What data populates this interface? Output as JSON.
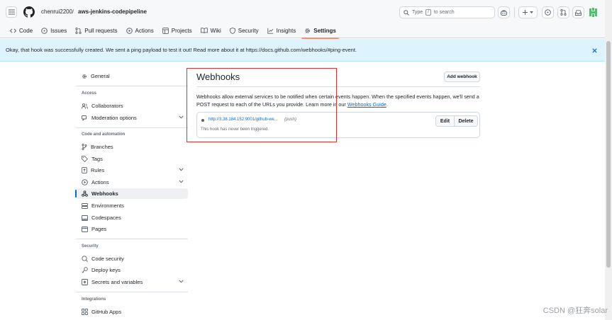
{
  "header": {
    "owner": "chenrui2200",
    "separator": "/",
    "repo": "aws-jenkins-codepipeline",
    "search": {
      "prefix": "Type",
      "key": "/",
      "suffix": "to search"
    }
  },
  "nav": {
    "tabs": [
      {
        "label": "Code",
        "icon": "code-icon"
      },
      {
        "label": "Issues",
        "icon": "issue-icon"
      },
      {
        "label": "Pull requests",
        "icon": "pull-request-icon"
      },
      {
        "label": "Actions",
        "icon": "play-icon"
      },
      {
        "label": "Projects",
        "icon": "table-icon"
      },
      {
        "label": "Wiki",
        "icon": "book-icon"
      },
      {
        "label": "Security",
        "icon": "shield-icon"
      },
      {
        "label": "Insights",
        "icon": "graph-icon"
      },
      {
        "label": "Settings",
        "icon": "gear-icon",
        "active": true
      }
    ]
  },
  "flash": {
    "message": "Okay, that hook was successfully created. We sent a ping payload to test it out! Read more about it at https://docs.github.com/webhooks/#ping-event."
  },
  "sidebar": {
    "general": "General",
    "sections": {
      "access": "Access",
      "code_automation": "Code and automation",
      "security": "Security",
      "integrations": "Integrations"
    },
    "items": {
      "collaborators": "Collaborators",
      "moderation": "Moderation options",
      "branches": "Branches",
      "tags": "Tags",
      "rules": "Rules",
      "actions": "Actions",
      "webhooks": "Webhooks",
      "environments": "Environments",
      "codespaces": "Codespaces",
      "pages": "Pages",
      "code_security": "Code security",
      "deploy_keys": "Deploy keys",
      "secrets": "Secrets and variables",
      "github_apps": "GitHub Apps"
    }
  },
  "main": {
    "title": "Webhooks",
    "add_button": "Add webhook",
    "description_part1": "Webhooks allow external services to be notified when certain events happen. When the specified events happen, we'll send a POST request to each of the URLs you provide. Learn more in our",
    "description_link": "Webhooks Guide",
    "description_end": ".",
    "hook": {
      "url": "http://3.38.184.152:9001/github-we...",
      "event": "(push)",
      "status": "This hook has never been triggered.",
      "edit_label": "Edit",
      "delete_label": "Delete"
    }
  },
  "watermark": "CSDN @狂奔solar",
  "colors": {
    "accent": "#0969da",
    "active_tab_underline": "#fd8c73",
    "flash_bg": "#ddf4ff",
    "highlight_box": "#e03131"
  }
}
